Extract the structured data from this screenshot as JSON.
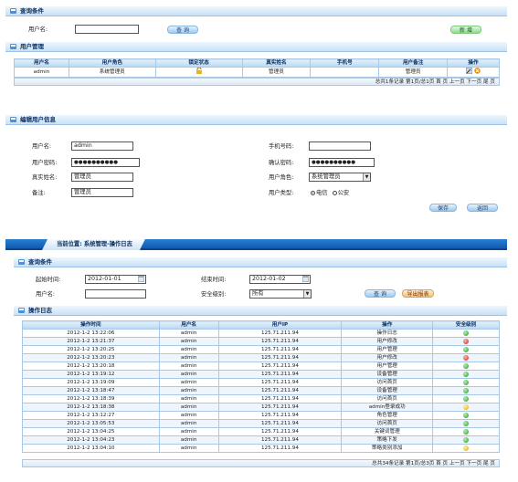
{
  "query_panel": {
    "title": "查询条件",
    "username_label": "用户名:",
    "username_value": "",
    "search_button": "查 询",
    "new_button": "新 增"
  },
  "user_manage": {
    "title": "用户管理",
    "columns": [
      "用户名",
      "用户角色",
      "锁定状态",
      "真实姓名",
      "手机号",
      "用户备注",
      "操作"
    ],
    "rows": [
      {
        "username": "admin",
        "role": "系统管理员",
        "lock_icon": "lock-icon",
        "real_name": "管理员",
        "phone": "",
        "note": "管理员",
        "edit_icon": "edit-icon",
        "delete_icon": "delete-icon"
      }
    ],
    "pager": "总共1条记录  第1页/总1页  首 页  上一页  下一页  尾 页"
  },
  "edit_user": {
    "title": "编辑用户信息",
    "username_label": "用户名:",
    "username_value": "admin",
    "password_label": "用户密码:",
    "password_value": "●●●●●●●●●●",
    "realname_label": "真实姓名:",
    "realname_value": "管理员",
    "note_label": "备注:",
    "note_value": "管理员",
    "phone_label": "手机号码:",
    "phone_value": "",
    "confirm_label": "确认密码:",
    "confirm_value": "●●●●●●●●●●",
    "role_label": "用户角色:",
    "role_value": "系统管理员",
    "type_label": "用户类型:",
    "type_options": [
      "电信",
      "公安"
    ],
    "type_selected": "电信",
    "save_button": "保存",
    "back_button": "返回"
  },
  "breadcrumb": {
    "text": "当前位置: 系统管理-操作日志"
  },
  "log_query": {
    "title": "查询条件",
    "start_label": "起始时间:",
    "start_value": "2012-01-01",
    "end_label": "结束时间:",
    "end_value": "2012-01-02",
    "username_label": "用户名:",
    "username_value": "",
    "level_label": "安全级别:",
    "level_value": "所有",
    "search_button": "查 询",
    "export_button": "导出报表"
  },
  "op_log": {
    "title": "操作日志",
    "columns": [
      "操作时间",
      "用户名",
      "用户IP",
      "操作",
      "安全级别"
    ],
    "rows": [
      {
        "time": "2012-1-2 13:22:06",
        "user": "admin",
        "ip": "125.71.211.94",
        "op": "操作日志",
        "level": "green"
      },
      {
        "time": "2012-1-2 13:21:37",
        "user": "admin",
        "ip": "125.71.211.94",
        "op": "用户修改",
        "level": "red"
      },
      {
        "time": "2012-1-2 13:20:25",
        "user": "admin",
        "ip": "125.71.211.94",
        "op": "用户管理",
        "level": "green"
      },
      {
        "time": "2012-1-2 13:20:23",
        "user": "admin",
        "ip": "125.71.211.94",
        "op": "用户修改",
        "level": "red"
      },
      {
        "time": "2012-1-2 13:20:18",
        "user": "admin",
        "ip": "125.71.211.94",
        "op": "用户管理",
        "level": "green"
      },
      {
        "time": "2012-1-2 13:19:12",
        "user": "admin",
        "ip": "125.71.211.94",
        "op": "设备管理",
        "level": "green"
      },
      {
        "time": "2012-1-2 13:19:09",
        "user": "admin",
        "ip": "125.71.211.94",
        "op": "访问首页",
        "level": "green"
      },
      {
        "time": "2012-1-2 13:18:47",
        "user": "admin",
        "ip": "125.71.211.94",
        "op": "设备管理",
        "level": "green"
      },
      {
        "time": "2012-1-2 13:18:39",
        "user": "admin",
        "ip": "125.71.211.94",
        "op": "访问首页",
        "level": "green"
      },
      {
        "time": "2012-1-2 13:18:38",
        "user": "admin",
        "ip": "125.71.211.94",
        "op": "admin登录成功",
        "level": "yellow"
      },
      {
        "time": "2012-1-2 13:12:27",
        "user": "admin",
        "ip": "125.71.211.94",
        "op": "角色管理",
        "level": "green"
      },
      {
        "time": "2012-1-2 13:05:53",
        "user": "admin",
        "ip": "125.71.211.94",
        "op": "访问首页",
        "level": "green"
      },
      {
        "time": "2012-1-2 13:04:25",
        "user": "admin",
        "ip": "125.71.211.94",
        "op": "关键词管理",
        "level": "green"
      },
      {
        "time": "2012-1-2 13:04:23",
        "user": "admin",
        "ip": "125.71.211.94",
        "op": "策略下发",
        "level": "green"
      },
      {
        "time": "2012-1-2 13:04:10",
        "user": "admin",
        "ip": "125.71.211.94",
        "op": "策略类别添加",
        "level": "yellow"
      }
    ],
    "pager": "总共34条记录  第1页/总3页  首 页  上一页  下一页  尾 页"
  }
}
